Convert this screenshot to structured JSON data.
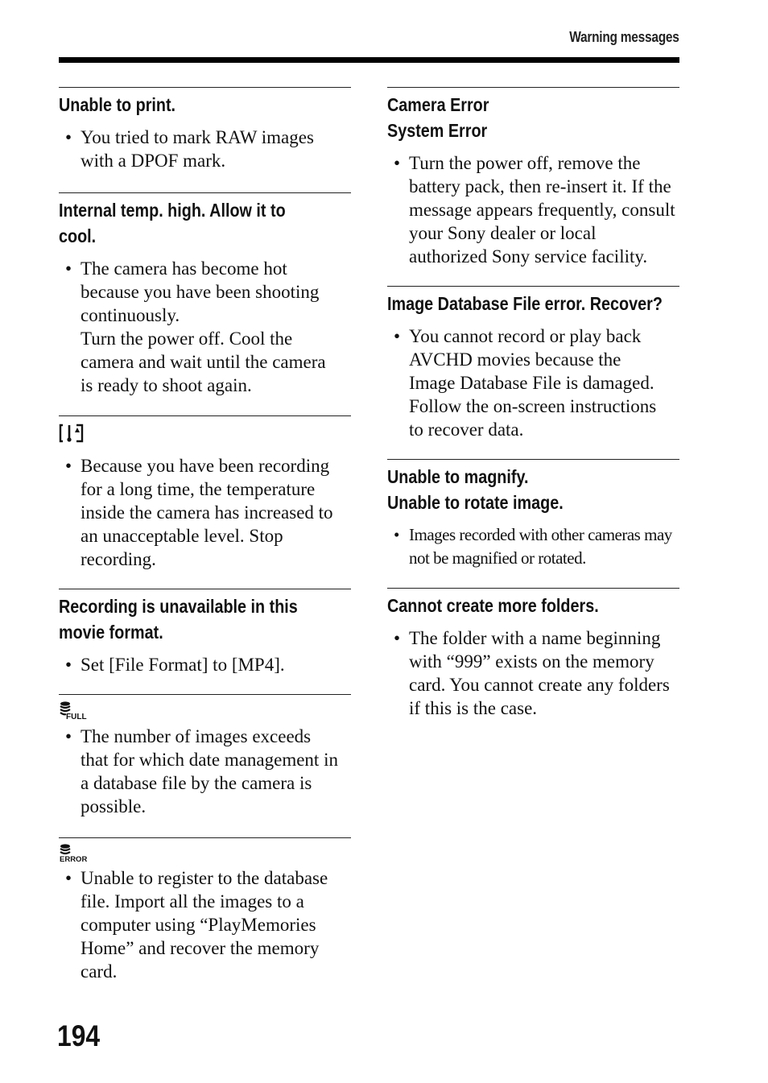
{
  "header": {
    "running_title": "Warning messages"
  },
  "left_column": {
    "sections": [
      {
        "heading": "Unable to print.",
        "bullets": [
          "You tried to mark RAW images with a DPOF mark."
        ]
      },
      {
        "heading_lines": [
          "Internal temp. high. Allow it to",
          "cool."
        ],
        "bullets": [
          "The camera has become hot because you have been shooting continuously.\nTurn the power off. Cool the camera and wait until the camera is ready to shoot again."
        ]
      },
      {
        "icon": "overheat-icon",
        "bullets": [
          "Because you have been recording for a long time, the temperature inside the camera has increased to an unacceptable level. Stop recording."
        ]
      },
      {
        "heading_lines": [
          "Recording is unavailable in this",
          "movie format."
        ],
        "bullets": [
          "Set [File Format] to [MP4]."
        ]
      },
      {
        "icon": "database-full-icon",
        "icon_label": "FULL",
        "bullets": [
          "The number of images exceeds that for which date management in a database file by the camera is possible."
        ]
      },
      {
        "icon": "database-error-icon",
        "icon_label": "ERROR",
        "bullets": [
          "Unable to register to the database file. Import all the images to a computer using “PlayMemories Home” and recover the memory card."
        ]
      }
    ]
  },
  "right_column": {
    "sections": [
      {
        "heading_lines": [
          "Camera Error",
          "System Error"
        ],
        "bullets": [
          "Turn the power off, remove the battery pack, then re-insert it. If the message appears frequently, consult your Sony dealer or local authorized Sony service facility."
        ]
      },
      {
        "heading": "Image Database File error. Recover?",
        "bullets": [
          "You cannot record or play back AVCHD movies because the Image Database File is damaged. Follow the on-screen instructions to recover data."
        ]
      },
      {
        "heading_lines": [
          "Unable to magnify.",
          "Unable to rotate image."
        ],
        "bullets": [
          "Images recorded with other cameras may not be magnified or rotated."
        ]
      },
      {
        "heading": "Cannot create more folders.",
        "bullets": [
          "The folder with a name beginning with “999” exists on the memory card. You cannot create any folders if this is the case."
        ]
      }
    ]
  },
  "footer": {
    "page_number": "194"
  }
}
